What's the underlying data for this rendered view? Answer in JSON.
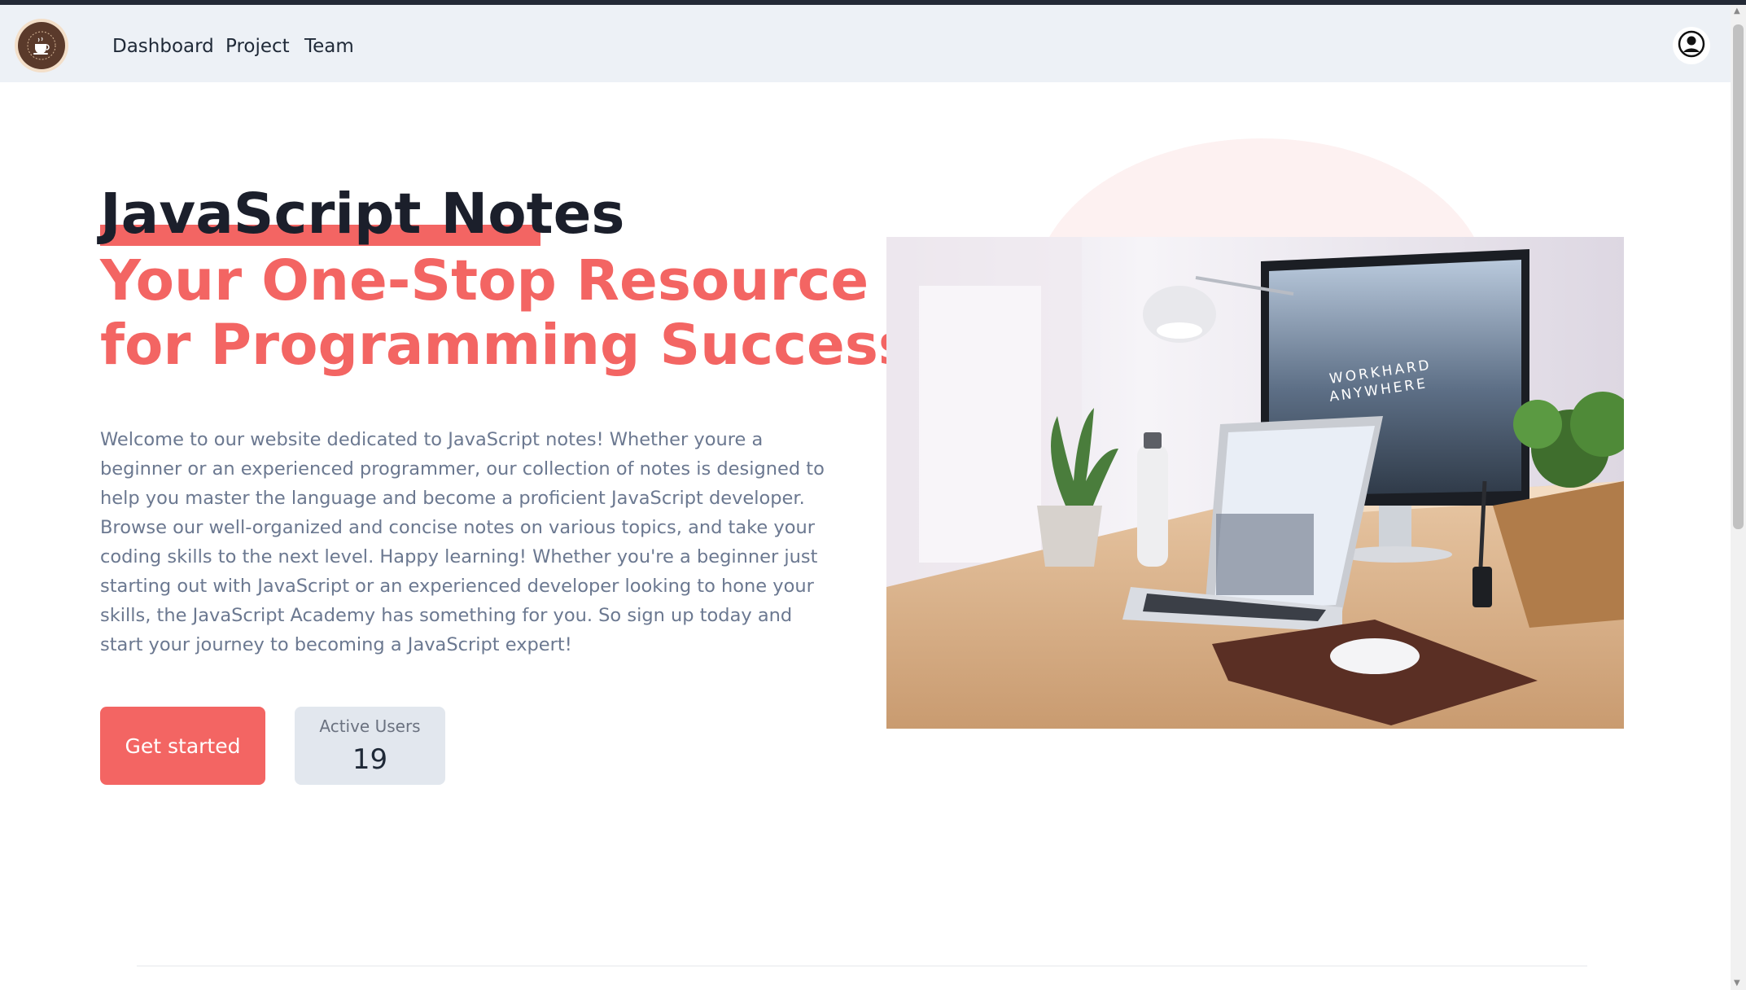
{
  "nav": {
    "logo_icon": "coffee-cup-logo",
    "links": [
      "Dashboard",
      "Project",
      "Team"
    ],
    "user_icon": "user-circle-icon"
  },
  "hero": {
    "title": "JavaScript Notes",
    "subtitle_line1": "Your One-Stop Resource",
    "subtitle_line2": "for Programming Success!",
    "description": "Welcome to our website dedicated to JavaScript notes! Whether youre a beginner or an experienced programmer, our collection of notes is designed to help you master the language and become a proficient JavaScript developer. Browse our well-organized and concise notes on various topics, and take your coding skills to the next level. Happy learning! Whether you're a beginner just starting out with JavaScript or an experienced developer looking to hone your skills, the JavaScript Academy has something for you. So sign up today and start your journey to becoming a JavaScript expert!",
    "cta_label": "Get started",
    "stats": {
      "label": "Active Users",
      "value": "19"
    },
    "image": {
      "alt": "desk workspace with monitor and laptop",
      "monitor_text_line1": "WORKHARD",
      "monitor_text_line2": "ANYWHERE"
    }
  },
  "colors": {
    "accent": "#f36563",
    "nav_bg": "#edf1f6",
    "heading": "#1b1f2b",
    "body_text": "#6b7890"
  }
}
